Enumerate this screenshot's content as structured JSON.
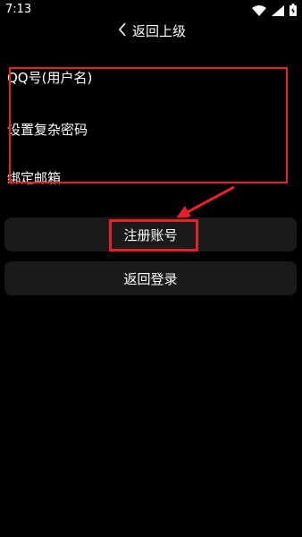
{
  "status": {
    "time": "7:13",
    "icons": [
      "wifi-icon",
      "signal-icon",
      "battery-icon"
    ]
  },
  "nav": {
    "back_label": "返回上级"
  },
  "form": {
    "fields": [
      {
        "label": "QQ号(用户名)"
      },
      {
        "label": "设置复杂密码"
      },
      {
        "label": "绑定邮箱"
      }
    ]
  },
  "buttons": {
    "register": "注册账号",
    "back_to_login": "返回登录"
  },
  "colors": {
    "background": "#000000",
    "button_bg": "#1a1a1a",
    "annotation_red": "#e4222a",
    "text": "#ffffff"
  }
}
